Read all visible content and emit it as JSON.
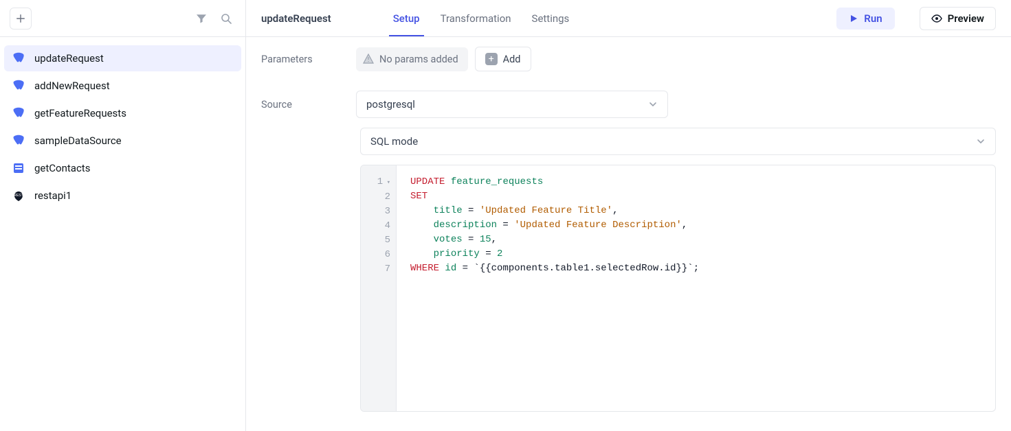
{
  "sidebar": {
    "items": [
      {
        "label": "updateRequest",
        "kind": "postgres",
        "active": true
      },
      {
        "label": "addNewRequest",
        "kind": "postgres",
        "active": false
      },
      {
        "label": "getFeatureRequests",
        "kind": "postgres",
        "active": false
      },
      {
        "label": "sampleDataSource",
        "kind": "postgres",
        "active": false
      },
      {
        "label": "getContacts",
        "kind": "sheets",
        "active": false
      },
      {
        "label": "restapi1",
        "kind": "restapi",
        "active": false
      }
    ]
  },
  "topbar": {
    "title": "updateRequest",
    "tabs": [
      {
        "label": "Setup",
        "active": true
      },
      {
        "label": "Transformation",
        "active": false
      },
      {
        "label": "Settings",
        "active": false
      }
    ],
    "run_label": "Run",
    "preview_label": "Preview"
  },
  "form": {
    "parameters_label": "Parameters",
    "no_params_text": "No params added",
    "add_label": "Add",
    "source_label": "Source",
    "source_value": "postgresql",
    "mode_value": "SQL mode"
  },
  "editor": {
    "line_numbers": [
      "1",
      "2",
      "3",
      "4",
      "5",
      "6",
      "7"
    ],
    "code": {
      "l1_kw": "UPDATE",
      "l1_ident": "feature_requests",
      "l2_kw": "SET",
      "l3_ident": "title",
      "l3_eq": " = ",
      "l3_str": "'Updated Feature Title'",
      "l3_tail": ",",
      "l4_ident": "description",
      "l4_eq": " = ",
      "l4_str": "'Updated Feature Description'",
      "l4_tail": ",",
      "l5_ident": "votes",
      "l5_eq": " = ",
      "l5_num": "15",
      "l5_tail": ",",
      "l6_ident": "priority",
      "l6_eq": " = ",
      "l6_num": "2",
      "l7_kw": "WHERE",
      "l7_ident": "id",
      "l7_eq": " = ",
      "l7_tpl": "`{{components.table1.selectedRow.id}}`",
      "l7_tail": ";"
    }
  }
}
